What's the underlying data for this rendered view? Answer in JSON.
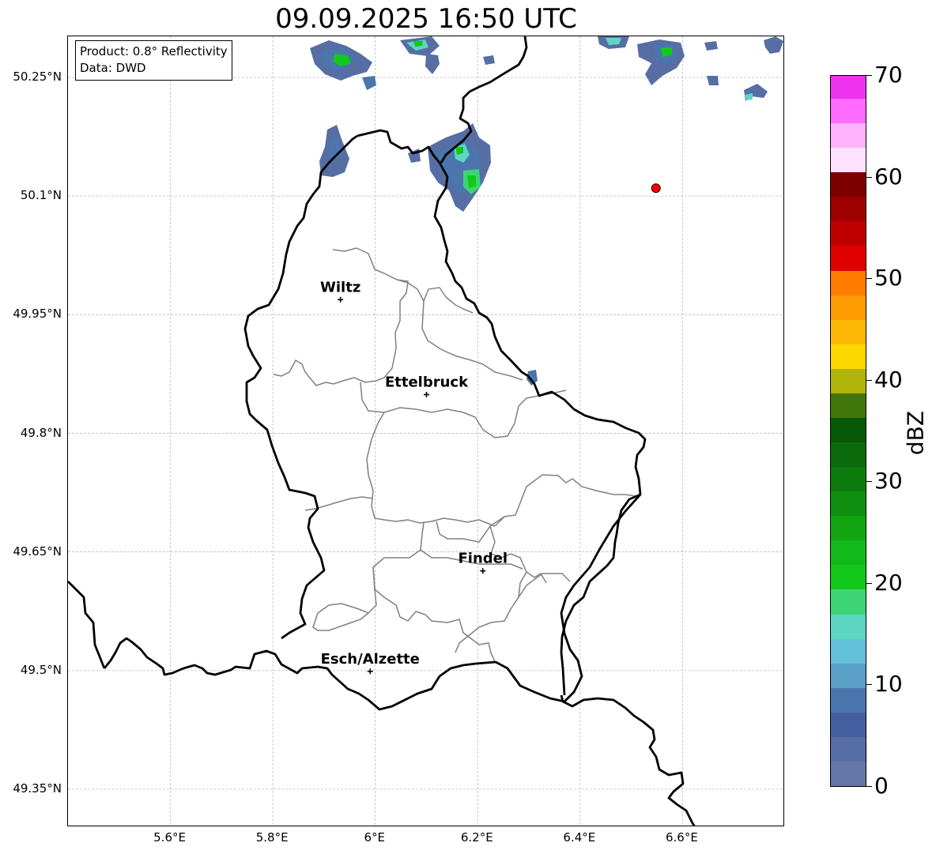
{
  "title": "09.09.2025 16:50 UTC",
  "info": {
    "product": "Product: 0.8° Reflectivity",
    "data_source": "Data: DWD"
  },
  "axes": {
    "lat_labels": [
      "50.25°N",
      "50.1°N",
      "49.95°N",
      "49.8°N",
      "49.65°N",
      "49.5°N",
      "49.35°N"
    ],
    "lon_labels": [
      "5.6°E",
      "5.8°E",
      "6°E",
      "6.2°E",
      "6.4°E",
      "6.6°E"
    ],
    "lat_values": [
      50.25,
      50.1,
      49.95,
      49.8,
      49.65,
      49.5,
      49.35
    ],
    "lon_values": [
      5.6,
      5.8,
      6.0,
      6.2,
      6.4,
      6.6
    ],
    "lat_range": [
      49.302,
      50.302
    ],
    "lon_range": [
      5.4,
      6.8
    ],
    "gridlines": true
  },
  "colorbar": {
    "title": "dBZ",
    "tick_labels": [
      "70",
      "60",
      "50",
      "40",
      "30",
      "20",
      "10",
      "0"
    ],
    "range": [
      0,
      70
    ],
    "step": 2.5,
    "colors": [
      "#6577a8",
      "#566ea3",
      "#445f9f",
      "#4a76ad",
      "#5a9fc6",
      "#64c1da",
      "#5dd6c4",
      "#3dd476",
      "#13c81a",
      "#11b91a",
      "#12a512",
      "#0f8f0f",
      "#0d7b0d",
      "#0b6a0b",
      "#065906",
      "#41760a",
      "#b0b308",
      "#fdd700",
      "#fdb805",
      "#fe9d03",
      "#ff7c00",
      "#e10000",
      "#bf0000",
      "#9f0000",
      "#7d0000",
      "#ffe2ff",
      "#ffb3ff",
      "#ff6bff",
      "#ee33ee"
    ]
  },
  "cities": [
    {
      "name": "Wiltz",
      "lat": 49.969,
      "lon": 5.932
    },
    {
      "name": "Ettelbruck",
      "lat": 49.849,
      "lon": 6.1
    },
    {
      "name": "Findel",
      "lat": 49.626,
      "lon": 6.21
    },
    {
      "name": "Esch/Alzette",
      "lat": 49.499,
      "lon": 5.99
    }
  ],
  "marker": {
    "lat": 50.11,
    "lon": 6.548,
    "color": "#ff0000"
  },
  "colors": {
    "national_border": "#000000",
    "canton_border": "#808080",
    "grid": "#b0b0b0"
  }
}
